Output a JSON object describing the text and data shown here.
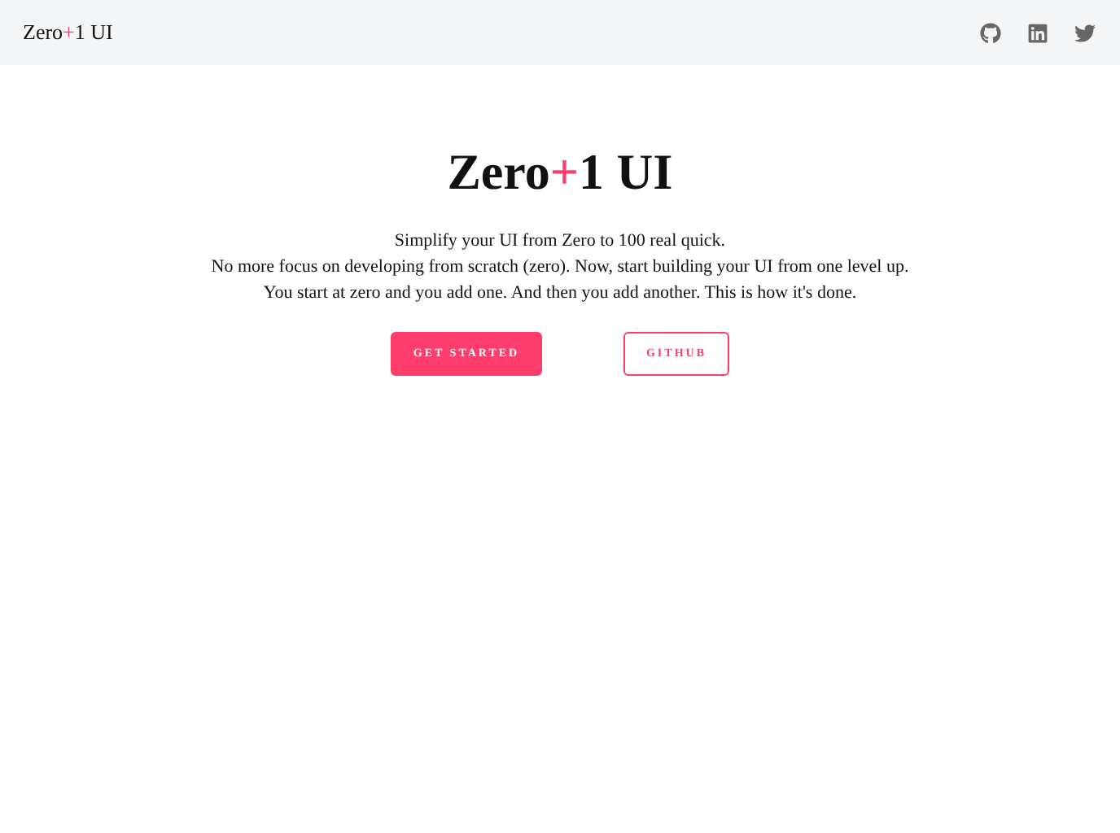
{
  "navbar": {
    "brand": {
      "before": "Zero",
      "plus": "+",
      "after": "1 UI"
    },
    "links": [
      {
        "kind": "github"
      },
      {
        "kind": "linkedin"
      },
      {
        "kind": "twitter"
      }
    ]
  },
  "hero": {
    "title": {
      "before": "Zero",
      "plus": "+",
      "after": "1 UI"
    },
    "lines": [
      "Simplify your UI from Zero to 100 real quick.",
      "No more focus on developing from scratch (zero). Now, start building your UI from one level up.",
      "You start at zero and you add one. And then you add another. This is how it's done."
    ],
    "buttons": [
      {
        "label": "GET STARTED",
        "kind": "primary"
      },
      {
        "label": "GITHUB",
        "kind": "outline"
      }
    ]
  }
}
